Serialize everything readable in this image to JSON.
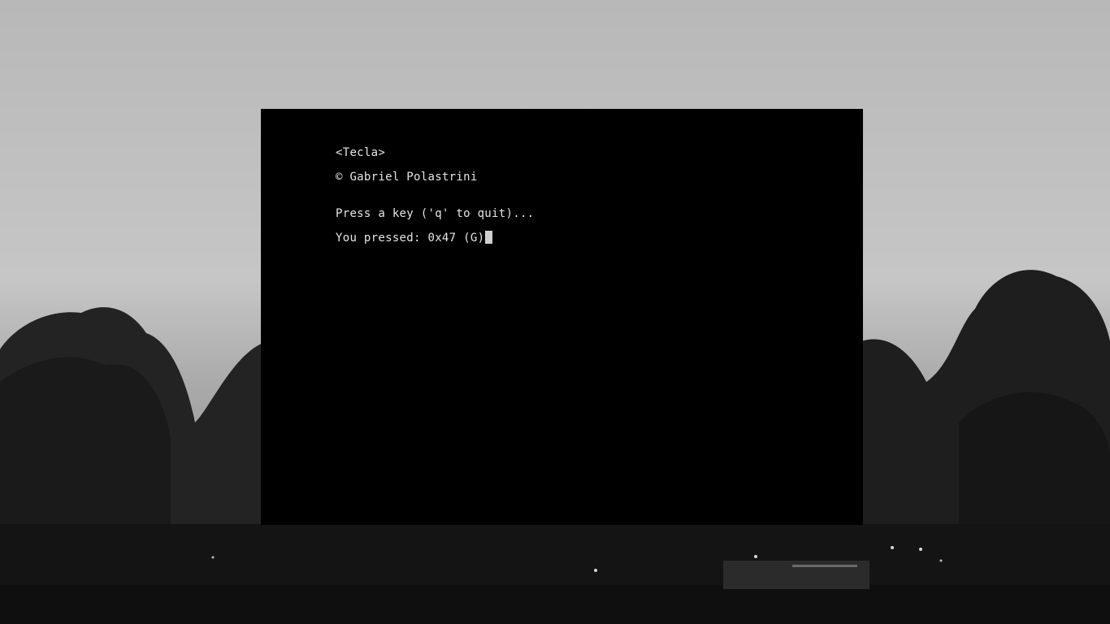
{
  "terminal": {
    "title_line": "<Tecla>",
    "copyright_line": "© Gabriel Polastrini",
    "prompt_line": "Press a key ('q' to quit)...",
    "result_line": "You pressed: 0x47 (G)"
  },
  "colors": {
    "terminal_background": "#000000",
    "terminal_text": "#e6e6e6",
    "cursor": "#cfcfcf"
  }
}
